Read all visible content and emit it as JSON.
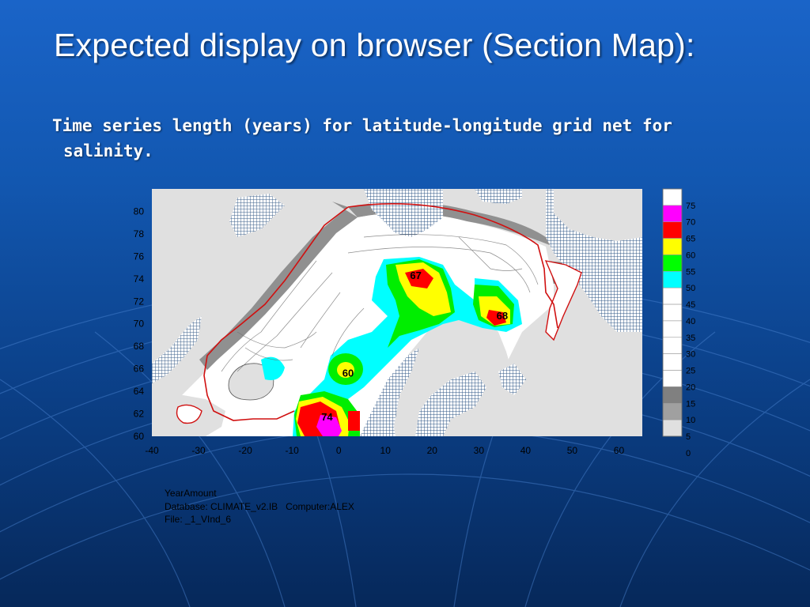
{
  "slide": {
    "title": "Expected display on browser (Section Map):",
    "subtitle_line1": "Time series length (years) for latitude-longitude grid net for",
    "subtitle_line2": "salinity.",
    "footer_line1": "YearAmount",
    "footer_line2": "Database: CLIMATE_v2.IB   Computer:ALEX",
    "footer_line3": "File: _1_VInd_6"
  },
  "map": {
    "y_ticks": [
      "80",
      "78",
      "76",
      "74",
      "72",
      "70",
      "68",
      "66",
      "64",
      "62",
      "60"
    ],
    "x_ticks": [
      "-40",
      "-30",
      "-20",
      "-10",
      "0",
      "10",
      "20",
      "30",
      "40",
      "50",
      "60"
    ],
    "contour_labels": [
      {
        "text": "67",
        "lon": 16.5,
        "lat": 74.0
      },
      {
        "text": "68",
        "lon": 35.0,
        "lat": 70.4
      },
      {
        "text": "60",
        "lon": 2.0,
        "lat": 65.3
      },
      {
        "text": "74",
        "lon": -2.5,
        "lat": 61.4
      }
    ],
    "colorbar": {
      "labels": [
        "75",
        "70",
        "65",
        "60",
        "55",
        "50",
        "45",
        "40",
        "35",
        "30",
        "25",
        "20",
        "15",
        "10",
        "5",
        "0"
      ],
      "colors": [
        "#ffffff",
        "#ff00ff",
        "#ff0000",
        "#ffff00",
        "#00ff00",
        "#00ffff",
        "#ffffff",
        "#ffffff",
        "#ffffff",
        "#ffffff",
        "#ffffff",
        "#ffffff",
        "#808080",
        "#a0a0a0",
        "#e0e0e0"
      ]
    },
    "colors": {
      "land": "#e0e0e0",
      "ocean": "#ffffff",
      "grid_cells": "#3a5f8a",
      "coast_band": "#808080",
      "outline": "#d01010"
    }
  }
}
